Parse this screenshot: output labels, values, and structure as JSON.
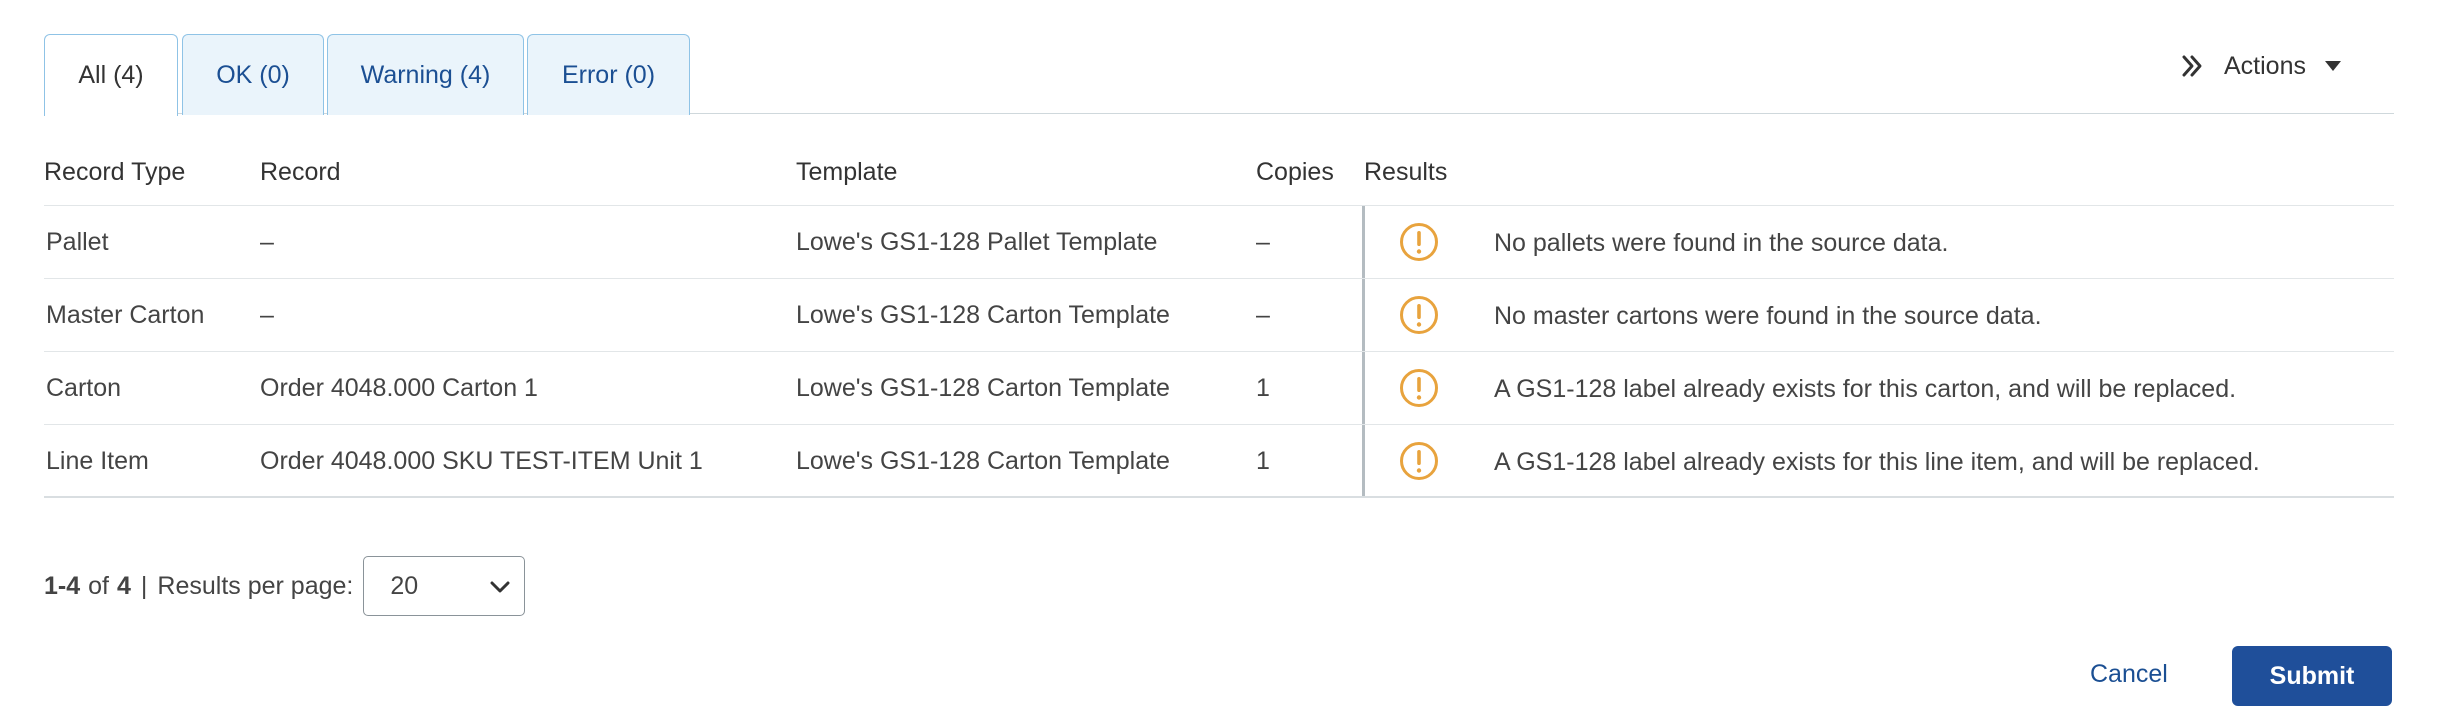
{
  "tabs": [
    {
      "label": "All (4)",
      "active": true
    },
    {
      "label": "OK (0)",
      "active": false
    },
    {
      "label": "Warning (4)",
      "active": false
    },
    {
      "label": "Error (0)",
      "active": false
    }
  ],
  "actions": {
    "label": "Actions",
    "icon": "double-chevron-right-icon",
    "caret": "caret-down-icon"
  },
  "table": {
    "headers": [
      "Record Type",
      "Record",
      "Template",
      "Copies",
      "Results"
    ],
    "rows": [
      {
        "type": "Pallet",
        "record": "–",
        "template": "Lowe's GS1-128 Pallet Template",
        "copies": "–",
        "status_icon": "warning-icon",
        "message": "No pallets were found in the source data."
      },
      {
        "type": "Master Carton",
        "record": "–",
        "template": "Lowe's GS1-128 Carton Template",
        "copies": "–",
        "status_icon": "warning-icon",
        "message": "No master cartons were found in the source data."
      },
      {
        "type": "Carton",
        "record": "Order 4048.000 Carton 1",
        "template": "Lowe's GS1-128 Carton Template",
        "copies": "1",
        "status_icon": "warning-icon",
        "message": "A GS1-128 label already exists for this carton, and will be replaced."
      },
      {
        "type": "Line Item",
        "record": "Order 4048.000 SKU TEST-ITEM Unit 1",
        "template": "Lowe's GS1-128 Carton Template",
        "copies": "1",
        "status_icon": "warning-icon",
        "message": "A GS1-128 label already exists for this line item, and will be replaced."
      }
    ]
  },
  "pagination": {
    "range": "1-4",
    "of": "of",
    "total": "4",
    "separator": "|",
    "per_page_label": "Results per page:",
    "per_page_value": "20"
  },
  "footer": {
    "cancel_label": "Cancel",
    "submit_label": "Submit"
  },
  "colors": {
    "accent": "#1f4f9a",
    "link": "#1b4f93",
    "warning": "#e8a33d",
    "tab_bg": "#eaf4fb",
    "tab_border": "#8fc3e6"
  }
}
